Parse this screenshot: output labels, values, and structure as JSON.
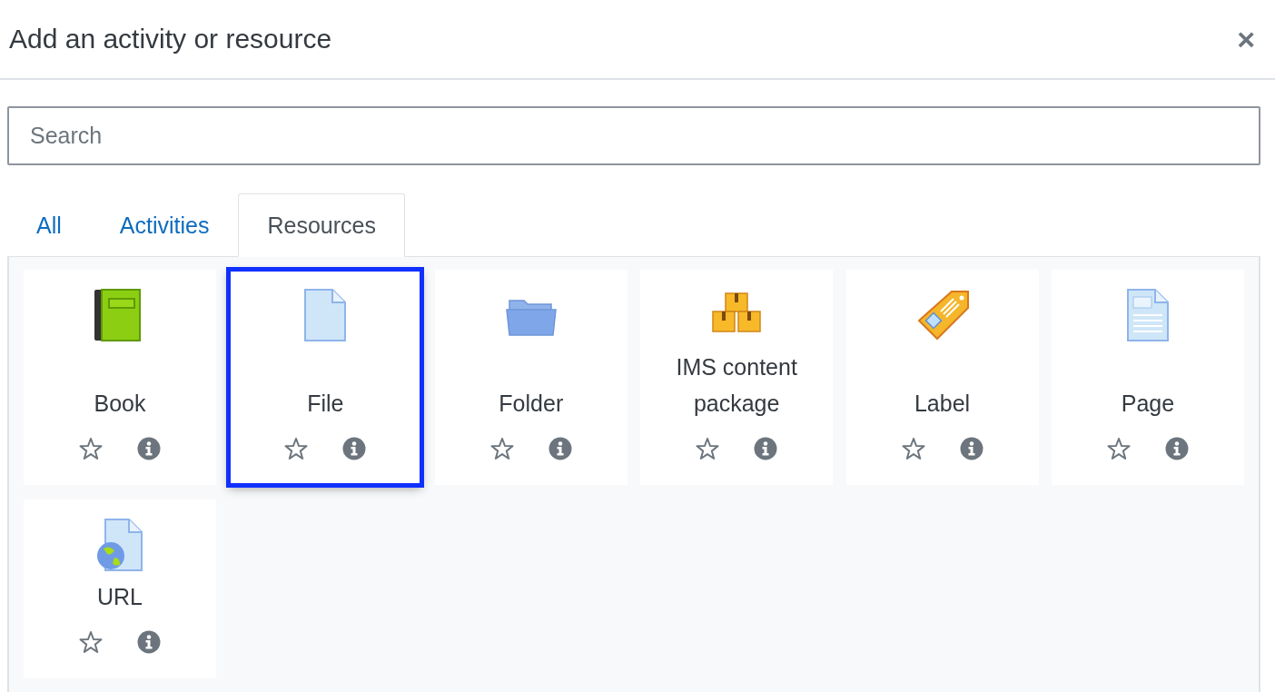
{
  "dialog": {
    "title": "Add an activity or resource",
    "close": "×"
  },
  "search": {
    "placeholder": "Search"
  },
  "tabs": [
    {
      "label": "All",
      "selected": false
    },
    {
      "label": "Activities",
      "selected": false
    },
    {
      "label": "Resources",
      "selected": true
    }
  ],
  "items": [
    {
      "name": "Book",
      "kind": "book",
      "starred": false,
      "selected": false
    },
    {
      "name": "File",
      "kind": "file",
      "starred": false,
      "selected": true
    },
    {
      "name": "Folder",
      "kind": "folder",
      "starred": false,
      "selected": false
    },
    {
      "name": "IMS content package",
      "kind": "boxes",
      "starred": false,
      "selected": false
    },
    {
      "name": "Label",
      "kind": "tag",
      "starred": false,
      "selected": false
    },
    {
      "name": "Page",
      "kind": "page",
      "starred": false,
      "selected": false
    },
    {
      "name": "URL",
      "kind": "url",
      "starred": false,
      "selected": false
    }
  ]
}
